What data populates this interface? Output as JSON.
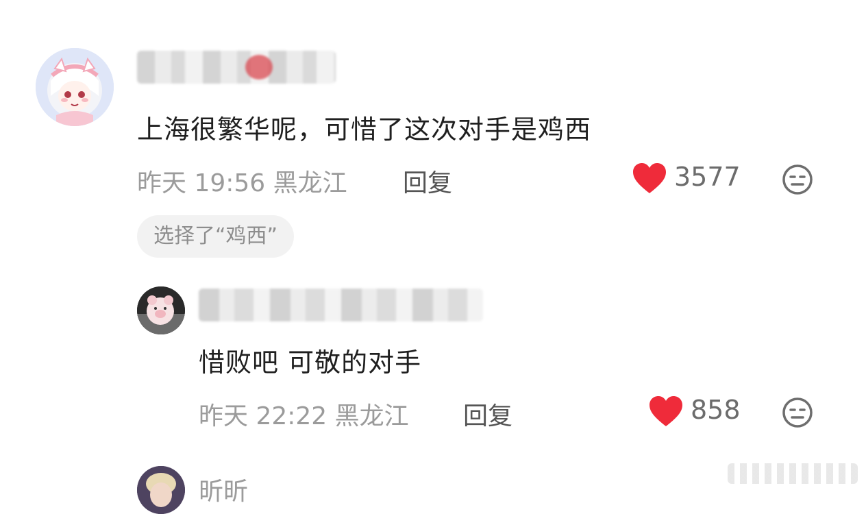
{
  "comments": [
    {
      "text": "上海很繁华呢，可惜了这次对手是鸡西",
      "time": "昨天 19:56",
      "location": "黑龙江",
      "reply_label": "回复",
      "likes": "3577",
      "choice_tag": "选择了“鸡西”"
    }
  ],
  "replies": [
    {
      "text": "惜败吧 可敬的对手",
      "time": "昨天 22:22",
      "location": "黑龙江",
      "reply_label": "回复",
      "likes": "858"
    }
  ],
  "next_comment": {
    "username": "昕昕"
  },
  "colors": {
    "heart": "#ef2b3a",
    "meta_text": "#9b9b9b",
    "pill_bg": "#f2f2f2"
  },
  "icons": {
    "like": "heart-icon",
    "reaction": "neutral-face-icon"
  }
}
